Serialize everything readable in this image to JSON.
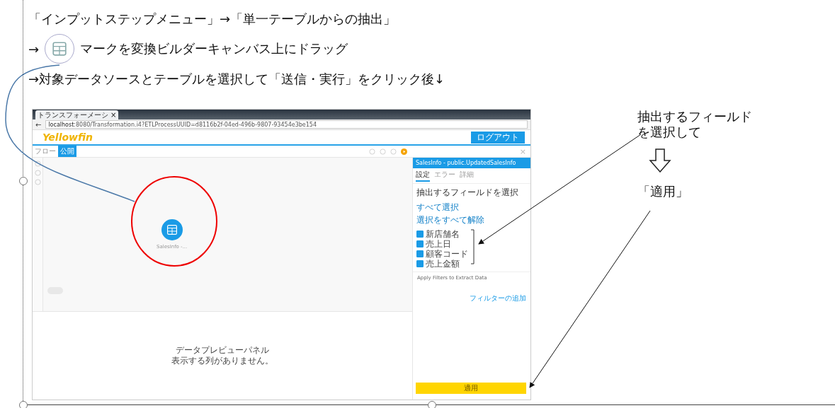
{
  "instructions": {
    "line_1": "「インプットステップメニュー」→「単一テーブルからの抽出」",
    "line_2_arrow": "→",
    "line_2_text": "マークを変換ビルダーキャンバス上にドラッグ",
    "line_3": "→対象データソースとテーブルを選択して「送信・実行」をクリック後↓"
  },
  "browser": {
    "back": "←",
    "tab_title": "トランスフォーメーシ",
    "tab_close": "×",
    "url_host": "localhost",
    "url_rest": ":8080/Transformation.i4?ETLProcessUUID=d8116b2f-04ed-496b-9807-93454e3be154"
  },
  "app": {
    "logo": "Yellowfin",
    "logout": "ログアウト",
    "tabs": [
      {
        "label": "フロー",
        "selected": false
      },
      {
        "label": "公開",
        "selected": true
      }
    ],
    "close": "×",
    "node_label": "SalesInfo -...",
    "preview": {
      "title": "データプレビューパネル",
      "message": "表示する列がありません。"
    }
  },
  "panel": {
    "title": "SalesInfo - public.UpdatedSalesInfo",
    "tabs": [
      {
        "label": "設定",
        "selected": true
      },
      {
        "label": "エラー",
        "selected": false
      },
      {
        "label": "詳細",
        "selected": false
      }
    ],
    "fields_heading": "抽出するフィールドを選択",
    "select_all": "すべて選択",
    "deselect_all": "選択をすべて解除",
    "fields": [
      {
        "label": "新店舗名",
        "checked": true
      },
      {
        "label": "売上日",
        "checked": true
      },
      {
        "label": "顧客コード",
        "checked": true
      },
      {
        "label": "売上金額",
        "checked": true
      }
    ],
    "filters_heading": "Apply Filters to Extract Data",
    "add_filter": "フィルターの追加",
    "apply": "適用"
  },
  "annotations": {
    "select_note": [
      "抽出するフィールド",
      "を選択して"
    ],
    "apply_note": "「適用」"
  }
}
